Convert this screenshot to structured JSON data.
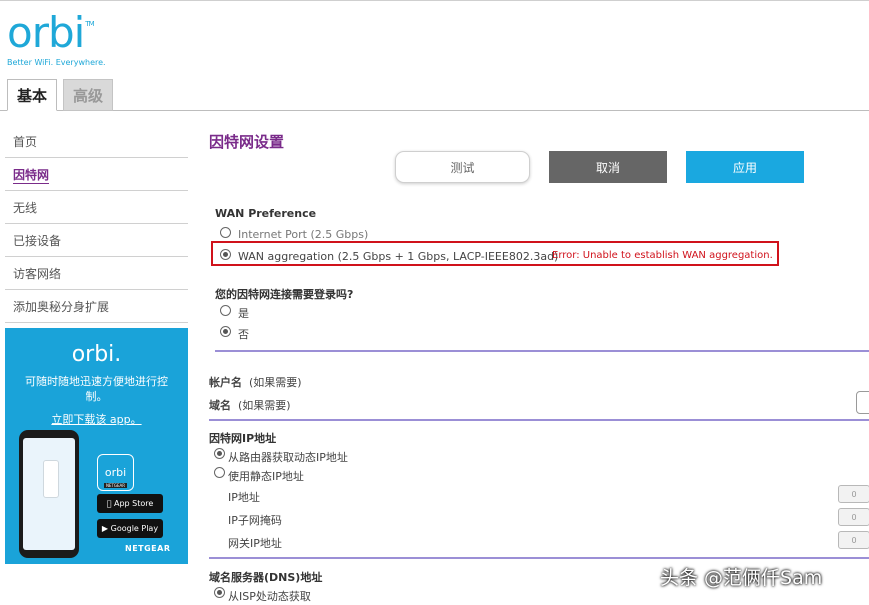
{
  "brand": {
    "logo": "orbi",
    "trademark": "TM",
    "tagline": "Better WiFi. Everywhere."
  },
  "tabs": [
    {
      "label": "基本",
      "active": true
    },
    {
      "label": "高级",
      "active": false
    }
  ],
  "sidebar": {
    "items": [
      {
        "label": "首页",
        "active": false
      },
      {
        "label": "因特网",
        "active": true
      },
      {
        "label": "无线",
        "active": false
      },
      {
        "label": "已接设备",
        "active": false
      },
      {
        "label": "访客网络",
        "active": false
      },
      {
        "label": "添加奥秘分身扩展",
        "active": false
      }
    ]
  },
  "promo": {
    "logo": "orbi.",
    "text": "可随时随地迅速方便地进行控制。",
    "link": "立即下载该 app。",
    "app_icon_label": "orbi",
    "app_icon_badge": "NETGEAR",
    "app_store": "App Store",
    "google_play": "Google Play",
    "brand": "NETGEAR"
  },
  "main": {
    "title": "因特网设置",
    "buttons": {
      "test": "测试",
      "cancel": "取消",
      "apply": "应用"
    },
    "wan_preference": {
      "heading": "WAN Preference",
      "options": [
        {
          "label": "Internet Port (2.5 Gbps)",
          "selected": false
        },
        {
          "label": "WAN aggregation (2.5 Gbps + 1 Gbps, LACP-IEEE802.3ad)",
          "selected": true
        }
      ],
      "error": "Error: Unable to establish WAN aggregation."
    },
    "login_question": {
      "heading": "您的因特网连接需要登录吗?",
      "options": [
        {
          "label": "是",
          "selected": false
        },
        {
          "label": "否",
          "selected": true
        }
      ]
    },
    "account_name": {
      "label": "帐户名",
      "hint": "(如果需要)"
    },
    "domain_name": {
      "label": "域名",
      "hint": "(如果需要)"
    },
    "ip_section": {
      "heading": "因特网IP地址",
      "options": [
        {
          "label": "从路由器获取动态IP地址",
          "selected": true
        },
        {
          "label": "使用静态IP地址",
          "selected": false
        }
      ],
      "fields": [
        {
          "label": "IP地址",
          "value": "0"
        },
        {
          "label": "IP子网掩码",
          "value": "0"
        },
        {
          "label": "网关IP地址",
          "value": "0"
        }
      ]
    },
    "dns_section": {
      "heading": "域名服务器(DNS)地址",
      "options": [
        {
          "label": "从ISP处动态获取",
          "selected": true
        }
      ]
    }
  },
  "watermark": "头条 @范俩仟Sam",
  "colors": {
    "brand_blue": "#1aa3d9",
    "accent_purple": "#7a2b8a",
    "error_red": "#d0121b",
    "apply_blue": "#1aa8e0",
    "cancel_gray": "#666666"
  }
}
